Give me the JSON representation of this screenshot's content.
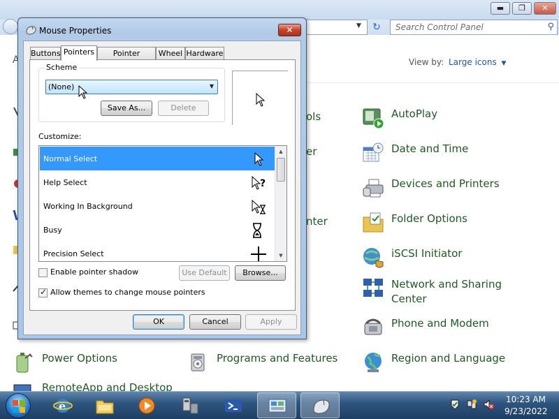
{
  "control_panel": {
    "search_placeholder": "Search Control Panel",
    "view_by_label": "View by:",
    "view_by_value": "Large icons",
    "view_by_arrow": "▼",
    "header_partial": "A",
    "partial_labels": [
      "ols",
      "er",
      "nter"
    ],
    "items": [
      {
        "label": "AutoPlay",
        "icon": "autoplay-icon"
      },
      {
        "label": "Date and Time",
        "icon": "date-time-icon"
      },
      {
        "label": "Devices and Printers",
        "icon": "devices-printers-icon"
      },
      {
        "label": "Folder Options",
        "icon": "folder-options-icon"
      },
      {
        "label": "iSCSI Initiator",
        "icon": "iscsi-icon"
      },
      {
        "label": "Network and Sharing Center",
        "icon": "network-sharing-icon"
      },
      {
        "label": "Phone and Modem",
        "icon": "phone-modem-icon"
      },
      {
        "label": "Power Options",
        "icon": "power-options-icon"
      },
      {
        "label": "Programs and Features",
        "icon": "programs-features-icon"
      },
      {
        "label": "Region and Language",
        "icon": "region-language-icon"
      },
      {
        "label": "RemoteApp and Desktop",
        "icon": "remoteapp-icon"
      }
    ],
    "window_controls": {
      "minimize": "▬",
      "maximize": "❐",
      "close": "✕"
    }
  },
  "dialog": {
    "title": "Mouse Properties",
    "close_glyph": "✕",
    "tabs": [
      "Buttons",
      "Pointers",
      "Pointer Options",
      "Wheel",
      "Hardware"
    ],
    "selected_tab": "Pointers",
    "scheme_label": "Scheme",
    "scheme_value": "(None)",
    "save_as_label": "Save As...",
    "delete_label": "Delete",
    "customize_label": "Customize:",
    "cursors": [
      {
        "name": "Normal Select",
        "icon": "arrow-cursor-icon",
        "selected": true
      },
      {
        "name": "Help Select",
        "icon": "help-cursor-icon",
        "selected": false
      },
      {
        "name": "Working In Background",
        "icon": "working-cursor-icon",
        "selected": false
      },
      {
        "name": "Busy",
        "icon": "hourglass-cursor-icon",
        "selected": false
      },
      {
        "name": "Precision Select",
        "icon": "crosshair-cursor-icon",
        "selected": false
      }
    ],
    "enable_shadow_label": "Enable pointer shadow",
    "enable_shadow_checked": false,
    "allow_themes_label": "Allow themes to change mouse pointers",
    "allow_themes_checked": true,
    "use_default_label": "Use Default",
    "browse_label": "Browse...",
    "ok_label": "OK",
    "cancel_label": "Cancel",
    "apply_label": "Apply"
  },
  "taskbar": {
    "buttons": [
      "ie-icon",
      "explorer-icon",
      "media-player-icon",
      "network-computers-icon",
      "powershell-icon",
      "control-panel-icon",
      "mouse-icon"
    ],
    "active_buttons": [
      "control-panel-icon",
      "mouse-icon"
    ],
    "clock_time": "10:23 AM",
    "clock_date": "9/23/2022"
  },
  "colors": {
    "selection": "#3399ff",
    "link_green": "#1e5a20",
    "link_blue": "#1e57a4"
  }
}
